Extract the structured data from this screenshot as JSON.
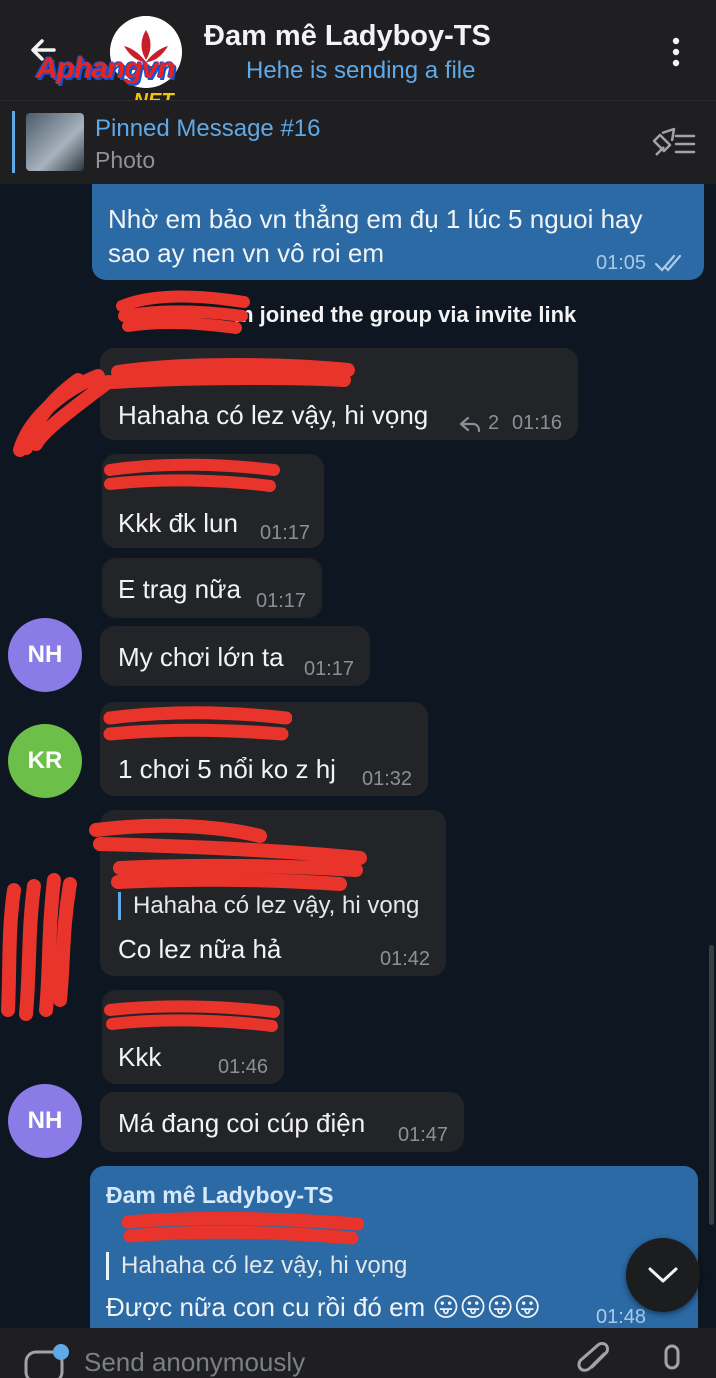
{
  "header": {
    "title": "Đam mê Ladyboy-TS",
    "status": "Hehe is sending a file",
    "watermark": "Aphangvn",
    "watermark_suffix": ".NET"
  },
  "pinned": {
    "title": "Pinned Message #16",
    "subtitle": "Photo"
  },
  "messages": [
    {
      "text_line1": "Nhờ em bảo vn thẳng em đụ 1 lúc 5 nguoi hay",
      "text_line2": "sao ay nen vn vô roi em",
      "time": "01:05"
    },
    {
      "service": "m joined the group via invite link"
    },
    {
      "text": "Hahaha có lez vậy, hi vọng",
      "replies": "2",
      "time": "01:16"
    },
    {
      "text": "Kkk đk lun",
      "time": "01:17"
    },
    {
      "text": "E trag nữa",
      "time": "01:17"
    },
    {
      "avatar": "NH",
      "text": "My chơi lớn ta",
      "time": "01:17"
    },
    {
      "avatar": "KR",
      "text": "1 chơi 5 nổi ko z hj",
      "time": "01:32"
    },
    {
      "quote": "Hahaha có lez vậy, hi vọng",
      "text": "Co lez nữa hả",
      "time": "01:42"
    },
    {
      "text": "Kkk",
      "time": "01:46"
    },
    {
      "avatar": "NH",
      "text": "Má đang coi cúp điện",
      "time": "01:47"
    },
    {
      "sender": "Đam mê Ladyboy-TS",
      "quote": "Hahaha có lez vậy, hi vọng",
      "text": "Được nữa con cu rồi đó em 😛😛😛😛",
      "time": "01:48"
    }
  ],
  "composer": {
    "placeholder": "Send anonymously"
  },
  "colors": {
    "background": "#0e1621",
    "incoming": "#232427",
    "outgoing": "#2b6aa5",
    "accent": "#5ea9e8",
    "avatar_nh": "#8a7be6",
    "avatar_kr": "#6cc04a",
    "redaction": "#e8342b"
  }
}
